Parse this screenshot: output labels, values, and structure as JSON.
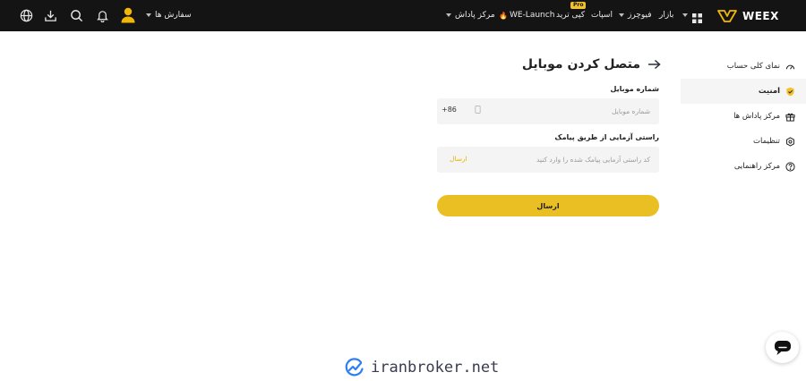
{
  "header": {
    "brand": "WEEX",
    "orders_label": "سفارش ها",
    "nav": {
      "market": "بازار",
      "futures": "فیوچرز",
      "spot": "اسپات",
      "copy_trade": "کپی ترید",
      "pro_badge": "Pro",
      "we_launch": "WE-Launch",
      "rewards": "مرکز پاداش"
    },
    "icons": [
      "globe-icon",
      "download-icon",
      "search-icon",
      "bell-icon",
      "user-icon",
      "apps-grid-icon"
    ]
  },
  "sidebar": {
    "items": [
      {
        "label": "نمای کلی حساب",
        "icon": "dashboard-icon",
        "active": false
      },
      {
        "label": "امنیت",
        "icon": "shield-check-icon",
        "active": true
      },
      {
        "label": "مرکز پاداش ها",
        "icon": "gift-icon",
        "active": false
      },
      {
        "label": "تنظیمات",
        "icon": "settings-icon",
        "active": false
      },
      {
        "label": "مرکز راهنمایی",
        "icon": "help-icon",
        "active": false
      }
    ]
  },
  "main": {
    "title": "متصل کردن موبایل",
    "phone": {
      "label": "شماره موبایل",
      "country_code": "+86",
      "placeholder": "شماره موبایل"
    },
    "sms": {
      "label": "راستی آزمایی از طریق پیامک",
      "placeholder": "کد راستی آزمایی پیامک شده را وارد کنید",
      "send_label": "ارسال"
    },
    "submit_label": "ارسال"
  },
  "watermark": {
    "text": "iranbroker.net"
  },
  "colors": {
    "accent": "#e9bf24",
    "topbar": "#141414",
    "link": "#e2b400"
  }
}
